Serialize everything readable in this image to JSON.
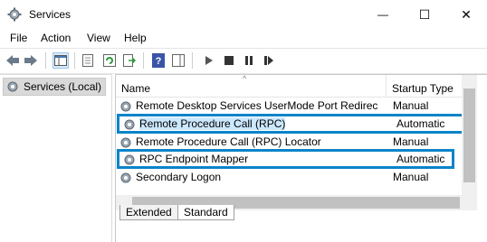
{
  "window": {
    "title": "Services",
    "minimize_glyph": "—",
    "maximize_glyph": "☐",
    "close_glyph": "✕"
  },
  "menu": [
    "File",
    "Action",
    "View",
    "Help"
  ],
  "toolbar": {
    "buttons": [
      "back-icon",
      "forward-icon",
      "show-console-tree-icon",
      "properties-icon",
      "refresh-icon",
      "export-list-icon",
      "help-icon",
      "show-hide-action-pane-icon",
      "start-service-icon",
      "stop-service-icon",
      "pause-service-icon",
      "restart-service-icon"
    ]
  },
  "tree": {
    "root": "Services (Local)"
  },
  "list": {
    "columns": {
      "name": "Name",
      "startup": "Startup Type"
    },
    "rows": [
      {
        "name": "Remote Desktop Services UserMode Port Redirec",
        "startup": "Manual",
        "highlighted": false
      },
      {
        "name": "Remote Procedure Call (RPC)",
        "startup": "Automatic",
        "highlighted": true
      },
      {
        "name": "Remote Procedure Call (RPC) Locator",
        "startup": "Manual",
        "highlighted": false
      },
      {
        "name": "RPC Endpoint Mapper",
        "startup": "Automatic",
        "highlighted": true
      },
      {
        "name": "Secondary Logon",
        "startup": "Manual",
        "highlighted": false
      }
    ]
  },
  "tabs": [
    "Extended",
    "Standard"
  ],
  "colors": {
    "highlight": "#0a84c9",
    "selection": "#cce8ff"
  }
}
